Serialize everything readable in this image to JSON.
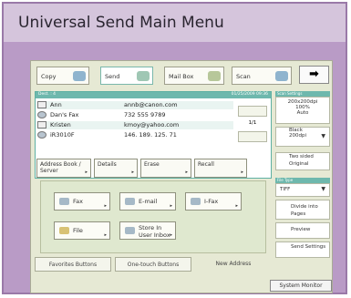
{
  "title": "Universal Send Main Menu",
  "tabs": [
    {
      "label": "Copy"
    },
    {
      "label": "Send"
    },
    {
      "label": "Mail Box"
    },
    {
      "label": "Scan"
    }
  ],
  "arrow_label": "➡",
  "list_header": {
    "left": "Dest. : 4",
    "right": "01/25/2009 09:36"
  },
  "address_list": [
    {
      "name": "Ann",
      "address": "annb@canon.com"
    },
    {
      "name": "Dan's Fax",
      "address": "732 555 9789"
    },
    {
      "name": "Kristen",
      "address": "kmoy@yahoo.com"
    },
    {
      "name": "iR3010F",
      "address": "146. 189. 125. 71"
    }
  ],
  "page_indicator": "1/1",
  "action_buttons": [
    {
      "label": "Address Book / Server"
    },
    {
      "label": "Details"
    },
    {
      "label": "Erase"
    },
    {
      "label": "Recall"
    }
  ],
  "scan_settings": {
    "header": "Scan Settings",
    "resolution": "200x200dpi",
    "zoom": "100%",
    "mode": "Auto",
    "color": "Black",
    "color_res": "200dpi"
  },
  "two_sided": "Two sided Original",
  "file_type": {
    "header": "File Type",
    "value": "TIFF"
  },
  "divide_pages": "Divide into Pages",
  "preview": "Preview",
  "send_settings": "Send Settings",
  "send_buttons": [
    {
      "label": "Fax"
    },
    {
      "label": "E-mail"
    },
    {
      "label": "I-Fax"
    },
    {
      "label": "File"
    },
    {
      "label": "Store In User Inbox"
    }
  ],
  "bottom_tabs": [
    {
      "label": "Favorites Buttons"
    },
    {
      "label": "One-touch Buttons"
    },
    {
      "label": "New Address"
    }
  ],
  "system_monitor": "System Monitor"
}
